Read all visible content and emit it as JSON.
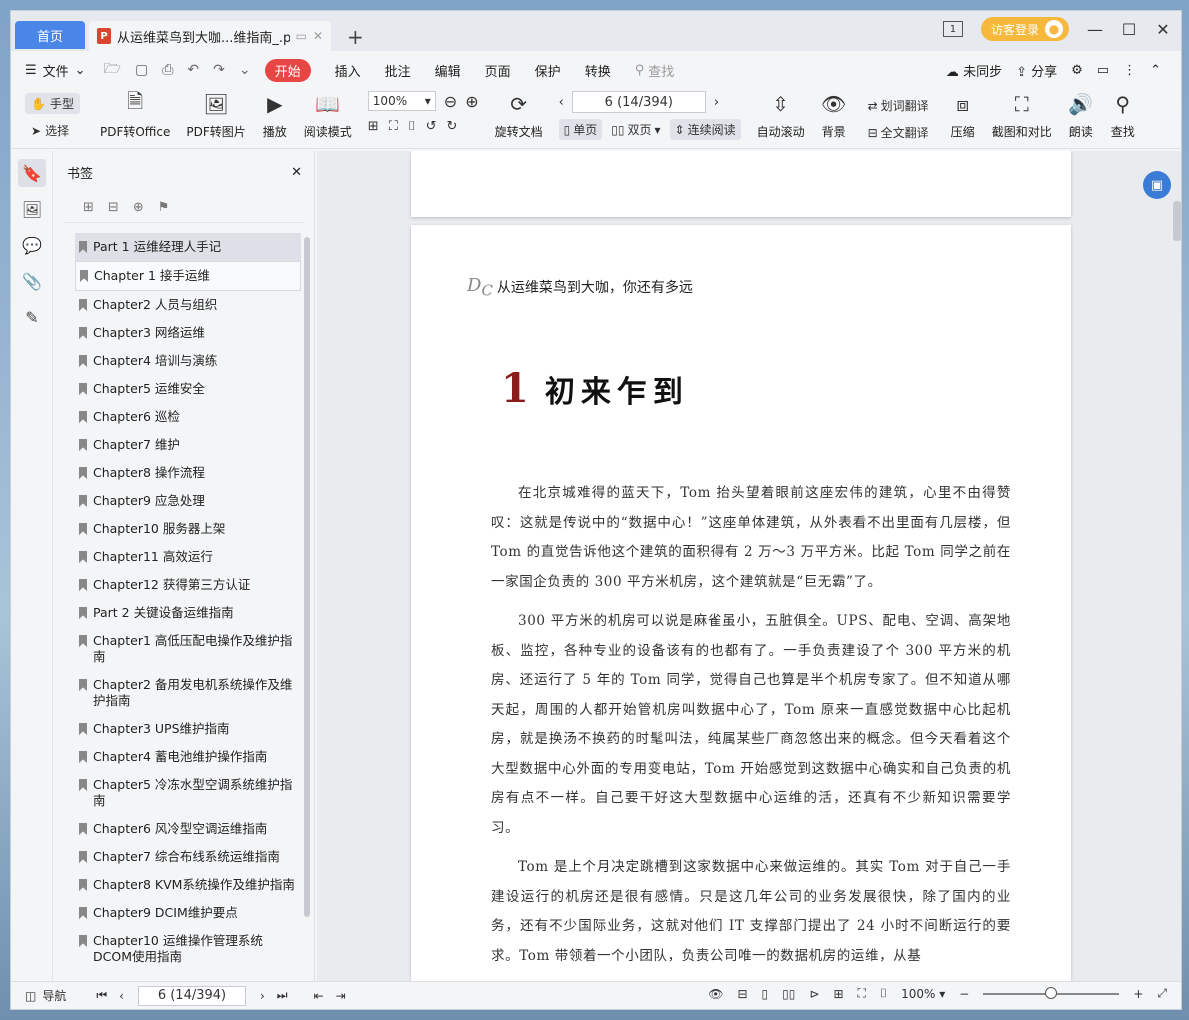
{
  "tabs": {
    "home": "首页",
    "doc_title": "从运维菜鸟到大咖...维指南_.pdf",
    "login": "访客登录"
  },
  "menu": {
    "file": "文件",
    "kaishi": "开始",
    "items": [
      "插入",
      "批注",
      "编辑",
      "页面",
      "保护",
      "转换"
    ],
    "search": "查找",
    "right": [
      "未同步",
      "分享"
    ]
  },
  "ribbon": {
    "hand": "手型",
    "select": "选择",
    "pdf_to_office": "PDF转Office",
    "pdf_to_image": "PDF转图片",
    "play": "播放",
    "read_mode": "阅读模式",
    "zoom": "100%",
    "page": "6 (14/394)",
    "rotate": "旋转文档",
    "single": "单页",
    "double": "双页",
    "continuous": "连续阅读",
    "auto_scroll": "自动滚动",
    "background": "背景",
    "word_translate": "划词翻译",
    "full_translate": "全文翻译",
    "compress": "压缩",
    "screenshot_compare": "截图和对比",
    "read_aloud": "朗读",
    "find": "查找"
  },
  "bookmarks": {
    "title": "书签",
    "items": [
      "Part 1 运维经理人手记",
      "Chapter 1 接手运维",
      "Chapter2 人员与组织",
      "Chapter3 网络运维",
      "Chapter4 培训与演练",
      "Chapter5 运维安全",
      "Chapter6 巡检",
      "Chapter7 维护",
      "Chapter8 操作流程",
      "Chapter9 应急处理",
      "Chapter10 服务器上架",
      "Chapter11 高效运行",
      "Chapter12 获得第三方认证",
      "Part 2 关键设备运维指南",
      "Chapter1 高低压配电操作及维护指南",
      "Chapter2 备用发电机系统操作及维护指南",
      "Chapter3 UPS维护指南",
      "Chapter4 蓄电池维护操作指南",
      "Chapter5 冷冻水型空调系统维护指南",
      "Chapter6 风冷型空调运维指南",
      "Chapter7 综合布线系统运维指南",
      "Chapter8 KVM系统操作及维护指南",
      "Chapter9 DCIM维护要点",
      "Chapter10 运维操作管理系统DCOM使用指南"
    ]
  },
  "document": {
    "running_head": "从运维菜鸟到大咖，你还有多远",
    "chapter_num": "1",
    "chapter_title": "初来乍到",
    "paragraphs": [
      "在北京城难得的蓝天下，Tom 抬头望着眼前这座宏伟的建筑，心里不由得赞叹：这就是传说中的“数据中心！”这座单体建筑，从外表看不出里面有几层楼，但 Tom 的直觉告诉他这个建筑的面积得有 2 万～3 万平方米。比起 Tom 同学之前在一家国企负责的 300 平方米机房，这个建筑就是“巨无霸”了。",
      "300 平方米的机房可以说是麻雀虽小，五脏俱全。UPS、配电、空调、高架地板、监控，各种专业的设备该有的也都有了。一手负责建设了个 300 平方米的机房、还运行了 5 年的 Tom 同学，觉得自己也算是半个机房专家了。但不知道从哪天起，周围的人都开始管机房叫数据中心了，Tom 原来一直感觉数据中心比起机房，就是换汤不换药的时髦叫法，纯属某些厂商忽悠出来的概念。但今天看着这个大型数据中心外面的专用变电站，Tom 开始感觉到这数据中心确实和自己负责的机房有点不一样。自己要干好这大型数据中心运维的活，还真有不少新知识需要学习。",
      "Tom 是上个月决定跳槽到这家数据中心来做运维的。其实 Tom 对于自己一手建设运行的机房还是很有感情。只是这几年公司的业务发展很快，除了国内的业务，还有不少国际业务，这就对他们 IT 支撑部门提出了 24 小时不间断运行的要求。Tom 带领着一个小团队，负责公司唯一的数据机房的运维，从基"
    ]
  },
  "statusbar": {
    "nav": "导航",
    "page": "6 (14/394)",
    "zoom": "100%"
  }
}
